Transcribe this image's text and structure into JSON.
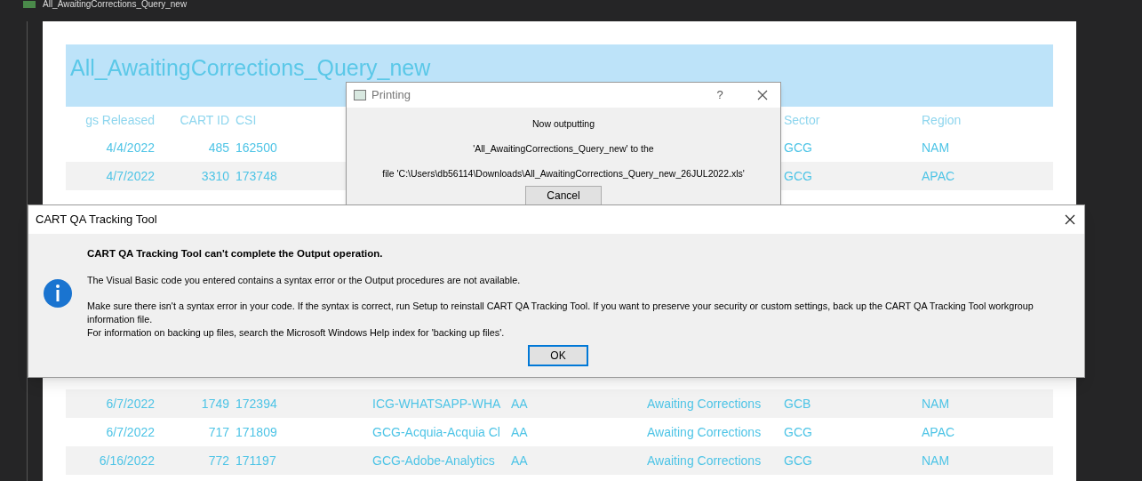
{
  "window": {
    "title": "All_AwaitingCorrections_Query_new"
  },
  "report": {
    "title": "All_AwaitingCorrections_Query_new",
    "columns": {
      "released": "gs Released",
      "cart_id": "CART ID",
      "csi": "CSI",
      "sector": "Sector",
      "region": "Region"
    },
    "rows_above": [
      {
        "released": "4/4/2022",
        "cart_id": "485",
        "csi": "162500",
        "sector": "GCG",
        "region": "NAM"
      },
      {
        "released": "4/7/2022",
        "cart_id": "3310",
        "csi": "173748",
        "sector": "GCG",
        "region": "APAC"
      }
    ],
    "rows_below": [
      {
        "released": "6/7/2022",
        "cart_id": "1749",
        "csi": "172394",
        "column_4": "ICG-WHATSAPP-WHA",
        "column_5": "AA",
        "column_6": "Awaiting Corrections",
        "sector": "GCB",
        "region": "NAM"
      },
      {
        "released": "6/7/2022",
        "cart_id": "717",
        "csi": "171809",
        "column_4": "GCG-Acquia-Acquia Cl",
        "column_5": "AA",
        "column_6": "Awaiting Corrections",
        "sector": "GCG",
        "region": "APAC"
      },
      {
        "released": "6/16/2022",
        "cart_id": "772",
        "csi": "171197",
        "column_4": "GCG-Adobe-Analytics",
        "column_5": "AA",
        "column_6": "Awaiting Corrections",
        "sector": "GCG",
        "region": "NAM"
      }
    ]
  },
  "printing_dialog": {
    "title": "Printing",
    "help": "?",
    "lines": [
      "Now outputting",
      "'All_AwaitingCorrections_Query_new' to the",
      "file 'C:\\Users\\db56114\\Downloads\\All_AwaitingCorrections_Query_new_26JUL2022.xls'"
    ],
    "button": "Cancel"
  },
  "error_dialog": {
    "title": "CART QA Tracking Tool",
    "heading": "CART QA Tracking Tool can't complete the Output operation.",
    "paragraphs": [
      "The Visual Basic code you entered contains a syntax error or the Output procedures are not available.",
      "Make sure there isn't a syntax error in your code. If the syntax is correct, run Setup to reinstall CART QA Tracking Tool. If you want to preserve your security or custom settings, back up the CART QA Tracking Tool workgroup information file.\nFor information on backing up files, search the Microsoft Windows Help index for 'backing up files'."
    ],
    "button": "OK"
  }
}
